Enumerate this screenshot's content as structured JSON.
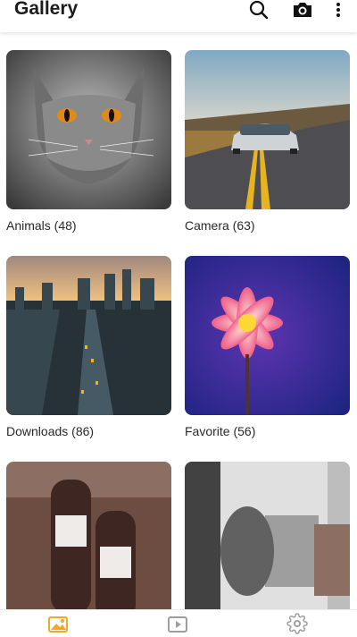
{
  "app_bar": {
    "title": "Gallery",
    "icons": [
      "search-icon",
      "camera-icon",
      "more-vert-icon"
    ]
  },
  "albums": [
    {
      "label": "Animals (48)",
      "name": "Animals",
      "count": 48
    },
    {
      "label": "Camera (63)",
      "name": "Camera",
      "count": 63
    },
    {
      "label": "Downloads (86)",
      "name": "Downloads",
      "count": 86
    },
    {
      "label": "Favorite (56)",
      "name": "Favorite",
      "count": 56
    },
    {
      "label": "",
      "name": "",
      "count": null
    },
    {
      "label": "",
      "name": "",
      "count": null
    }
  ],
  "bottom_nav": {
    "items": [
      "photos-icon",
      "videos-icon",
      "settings-icon"
    ],
    "active_index": 0,
    "active_color": "#f5a623",
    "inactive_color": "#9e9e9e"
  }
}
